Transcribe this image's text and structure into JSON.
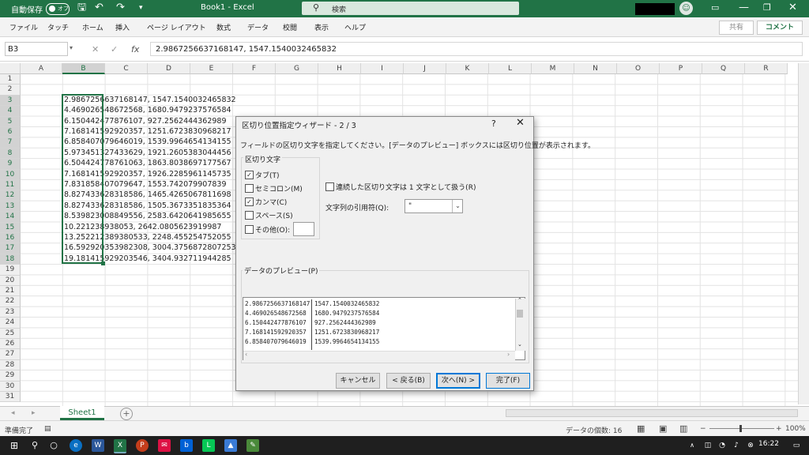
{
  "titlebar": {
    "autosave_label": "自動保存",
    "autosave_state": "オフ",
    "document_title": "Book1 - Excel",
    "search_placeholder": "検索"
  },
  "menu": [
    "ファイル",
    "タッチ",
    "ホーム",
    "挿入",
    "ページ レイアウト",
    "数式",
    "データ",
    "校閲",
    "表示",
    "ヘルプ"
  ],
  "share_label": "共有",
  "comment_label": "コメント",
  "formula_bar": {
    "name_box": "B3",
    "formula": "2.9867256637168147, 1547.1540032465832"
  },
  "columns": [
    "A",
    "B",
    "C",
    "D",
    "E",
    "F",
    "G",
    "H",
    "I",
    "J",
    "K",
    "L",
    "M",
    "N",
    "O",
    "P",
    "Q",
    "R"
  ],
  "rows": [
    "1",
    "2",
    "3",
    "4",
    "5",
    "6",
    "7",
    "8",
    "9",
    "10",
    "11",
    "12",
    "13",
    "14",
    "15",
    "16",
    "17",
    "18",
    "19",
    "20",
    "21",
    "22",
    "23",
    "24",
    "25",
    "26",
    "27",
    "28",
    "29",
    "30",
    "31"
  ],
  "cells": [
    "2.9867256637168147, 1547.1540032465832",
    "4.469026548672568, 1680.9479237576584",
    "6.150442477876107, 927.2562444362989",
    "7.168141592920357, 1251.6723830968217",
    "6.858407079646019, 1539.9964654134155",
    "5.973451327433629, 1921.2605383044456",
    "6.504424778761063, 1863.8038697177567",
    "7.168141592920357, 1926.2285961145735",
    "7.831858407079647, 1553.742079907839",
    "8.827433628318586, 1465.4265067811698",
    "8.827433628318586, 1505.3673351835364",
    "8.539823008849556, 2583.6420641985655",
    "10.221238938053, 2642.0805623919987",
    "13.252212389380533, 2248.455254752055",
    "16.592920353982308, 3004.3756872807253",
    "19.181415929203546, 3404.932711944285"
  ],
  "sheet_tab": "Sheet1",
  "status": {
    "ready": "準備完了",
    "count": "データの個数: 16",
    "zoom": "100%"
  },
  "clock": "16:22",
  "dialog": {
    "title": "区切り位置指定ウィザード - 2 / 3",
    "help": "?",
    "close": "✕",
    "description": "フィールドの区切り文字を指定してください。[データのプレビュー] ボックスには区切り位置が表示されます。",
    "delimiters_legend": "区切り文字",
    "delimiters": [
      {
        "label": "タブ(T)",
        "checked": true
      },
      {
        "label": "セミコロン(M)",
        "checked": false
      },
      {
        "label": "カンマ(C)",
        "checked": true
      },
      {
        "label": "スペース(S)",
        "checked": false
      },
      {
        "label": "その他(O):",
        "checked": false
      }
    ],
    "consecutive_label": "連続した区切り文字は 1 文字として扱う(R)",
    "qualifier_label": "文字列の引用符(Q):",
    "qualifier_value": "\"",
    "preview_legend": "データのプレビュー(P)",
    "preview_rows": [
      [
        "2.9867256637168147",
        "1547.1540032465832"
      ],
      [
        "4.469026548672568",
        "1680.9479237576584"
      ],
      [
        "6.150442477876107",
        "927.2562444362989"
      ],
      [
        "7.168141592920357",
        "1251.6723830968217"
      ],
      [
        "6.858407079646019",
        "1539.9964654134155"
      ]
    ],
    "buttons": {
      "cancel": "キャンセル",
      "back": "< 戻る(B)",
      "next": "次へ(N) >",
      "finish": "完了(F)"
    }
  },
  "colors": {
    "excel_green": "#217346",
    "dialog_bg": "#f0f0f0",
    "focus_blue": "#0078d7"
  }
}
